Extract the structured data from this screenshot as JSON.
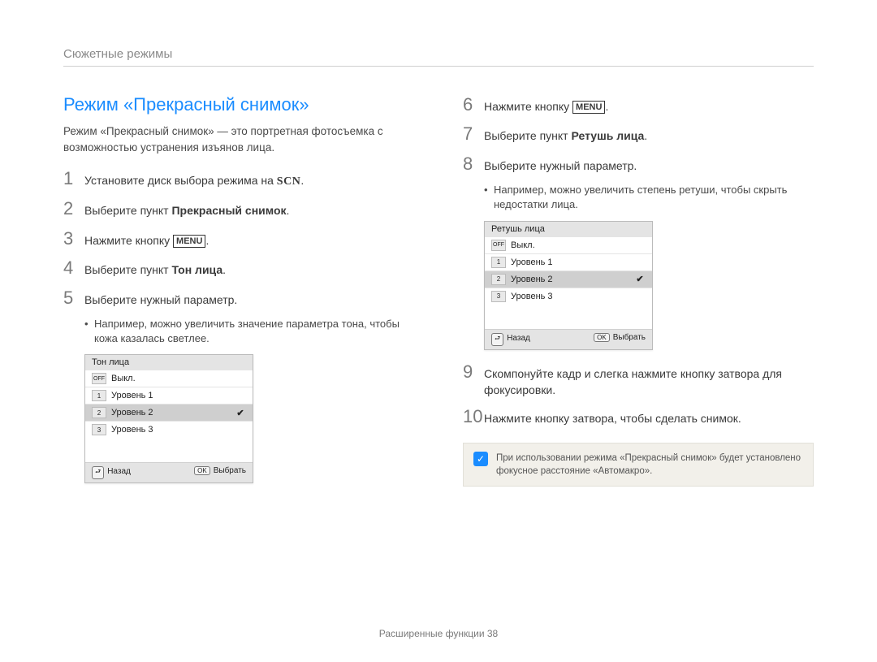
{
  "section_tag": "Сюжетные режимы",
  "left": {
    "heading": "Режим «Прекрасный снимок»",
    "intro": "Режим «Прекрасный снимок» — это портретная фотосъемка с возможностью устранения изъянов лица.",
    "step1_prefix": "Установите диск выбора режима на ",
    "step1_glyph": "SCN",
    "step2_prefix": "Выберите пункт ",
    "step2_bold": "Прекрасный снимок",
    "step3_prefix": "Нажмите кнопку ",
    "step3_menu": "MENU",
    "step4_prefix": "Выберите пункт ",
    "step4_bold": "Тон лица",
    "step5": "Выберите нужный параметр.",
    "step5_sub": "Например, можно увеличить значение параметра тона, чтобы кожа казалась светлее.",
    "lcd": {
      "title": "Тон лица",
      "items": [
        {
          "icon": "OFF",
          "label": "Выкл.",
          "selected": false
        },
        {
          "icon": "1",
          "label": "Уровень 1",
          "selected": false
        },
        {
          "icon": "2",
          "label": "Уровень 2",
          "selected": true
        },
        {
          "icon": "3",
          "label": "Уровень 3",
          "selected": false
        }
      ],
      "back_key": "⮐",
      "back": "Назад",
      "ok_key": "OK",
      "ok": "Выбрать"
    }
  },
  "right": {
    "step6_prefix": "Нажмите кнопку ",
    "step6_menu": "MENU",
    "step7_prefix": "Выберите пункт ",
    "step7_bold": "Ретушь лица",
    "step8": "Выберите нужный параметр.",
    "step8_sub": "Например, можно увеличить степень ретуши, чтобы скрыть недостатки лица.",
    "lcd": {
      "title": "Ретушь лица",
      "items": [
        {
          "icon": "OFF",
          "label": "Выкл.",
          "selected": false
        },
        {
          "icon": "1",
          "label": "Уровень 1",
          "selected": false
        },
        {
          "icon": "2",
          "label": "Уровень 2",
          "selected": true
        },
        {
          "icon": "3",
          "label": "Уровень 3",
          "selected": false
        }
      ],
      "back_key": "⮐",
      "back": "Назад",
      "ok_key": "OK",
      "ok": "Выбрать"
    },
    "step9": "Скомпонуйте кадр и слегка нажмите кнопку затвора для фокусировки.",
    "step10": "Нажмите кнопку затвора, чтобы сделать снимок.",
    "note": "При использовании режима «Прекрасный снимок» будет установлено фокусное расстояние «Автомакро»."
  },
  "footer_text": "Расширенные функции  38",
  "nums": {
    "n1": "1",
    "n2": "2",
    "n3": "3",
    "n4": "4",
    "n5": "5",
    "n6": "6",
    "n7": "7",
    "n8": "8",
    "n9": "9",
    "n10": "10"
  },
  "dot": ".",
  "check": "✔",
  "note_icon": "✓"
}
